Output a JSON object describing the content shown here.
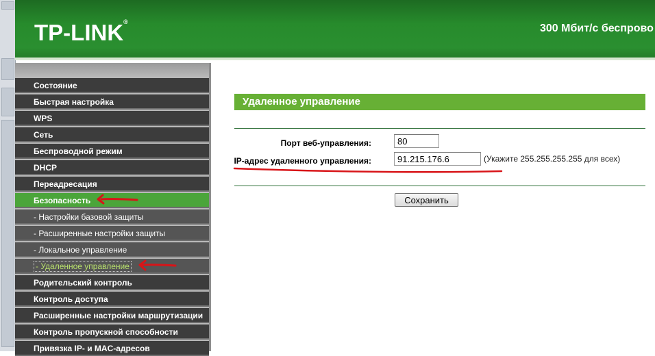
{
  "header": {
    "brand": "TP-LINK",
    "brand_mark": "®",
    "model_text": "300 Мбит/с беспрово"
  },
  "sidebar": {
    "items": [
      {
        "label": "Состояние"
      },
      {
        "label": "Быстрая настройка"
      },
      {
        "label": "WPS"
      },
      {
        "label": "Сеть"
      },
      {
        "label": "Беспроводной режим"
      },
      {
        "label": "DHCP"
      },
      {
        "label": "Переадресация"
      },
      {
        "label": "Безопасность"
      },
      {
        "label": "- Настройки базовой защиты"
      },
      {
        "label": "- Расширенные настройки защиты"
      },
      {
        "label": "- Локальное управление"
      },
      {
        "label": "- Удаленное управление"
      },
      {
        "label": "Родительский контроль"
      },
      {
        "label": "Контроль доступа"
      },
      {
        "label": "Расширенные настройки маршрутизации"
      },
      {
        "label": "Контроль пропускной способности"
      },
      {
        "label": "Привязка IP- и MAC-адресов"
      }
    ]
  },
  "main": {
    "title": "Удаленное управление",
    "port_label": "Порт веб-управления:",
    "port_value": "80",
    "ip_label": "IP-адрес удаленного управления:",
    "ip_value": "91.215.176.6",
    "ip_hint": "(Укажите 255.255.255.255 для всех)",
    "save_label": "Сохранить"
  },
  "colors": {
    "header_green": "#278b2c",
    "active_green": "#4ba53a",
    "title_green": "#67b035",
    "annotation_red": "#d81418"
  }
}
